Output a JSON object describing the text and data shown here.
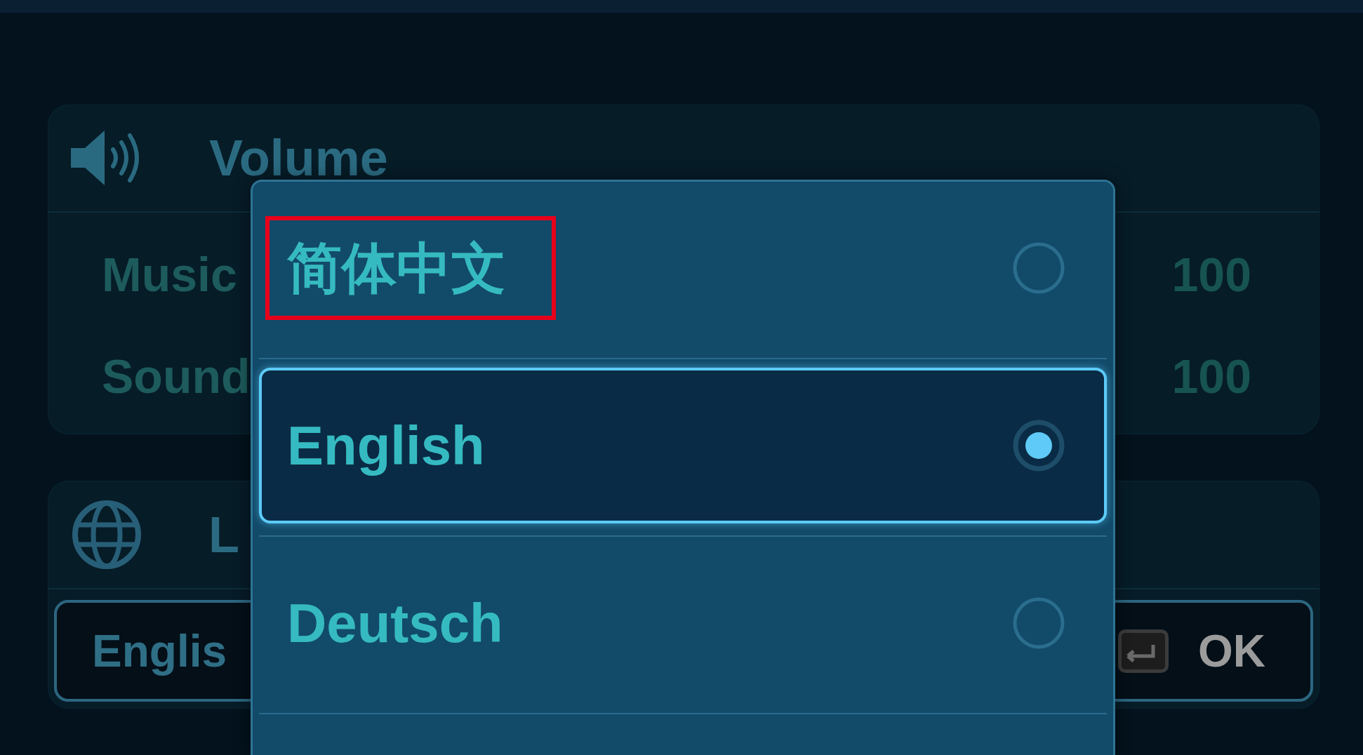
{
  "volume_panel": {
    "title": "Volume",
    "rows": [
      {
        "label": "Music",
        "value": "100"
      },
      {
        "label": "Sound",
        "value": "100"
      }
    ]
  },
  "language_panel": {
    "title": "L",
    "field": {
      "value": "Englis"
    },
    "confirm_button": {
      "label": "OK"
    }
  },
  "language_menu": {
    "options": [
      {
        "label": "简体中文",
        "selected": false,
        "highlighted": true
      },
      {
        "label": "English",
        "selected": true,
        "highlighted": false
      },
      {
        "label": "Deutsch",
        "selected": false,
        "highlighted": false
      }
    ]
  }
}
